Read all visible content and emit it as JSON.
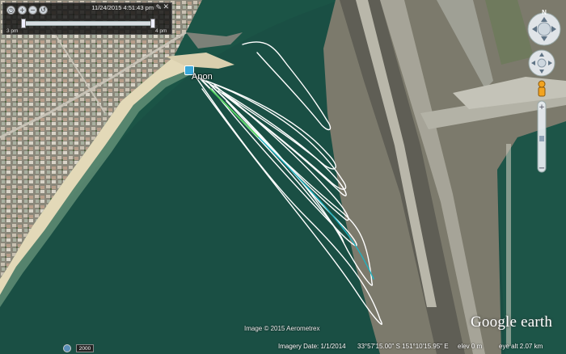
{
  "time_slider": {
    "timestamp": "11/24/2015  4:51:43 pm",
    "start_label": "3 pm",
    "end_label": "4 pm",
    "icons": [
      "clock-icon",
      "zoom-in-time-icon",
      "zoom-out-time-icon",
      "replay-icon",
      "wrench-icon",
      "close-icon"
    ]
  },
  "map": {
    "placemark_label": "Anon",
    "track_colors": {
      "primary": "#ffffff",
      "highlight_green": "#4ad65a",
      "highlight_cyan": "#1fb3c2"
    },
    "credit": "Image © 2015 Aerometrex",
    "brand": "Google earth"
  },
  "status_bar": {
    "year": "2000",
    "imagery_date": "Imagery Date: 1/1/2014",
    "coordinates": "33°57'15.00\" S  151°10'15.95\" E",
    "elevation": "elev    0 m",
    "eye_alt": "eye alt   2.07 km"
  },
  "navigation": {
    "north_label": "N",
    "icons": [
      "look-control-icon",
      "move-control-icon",
      "street-view-pegman-icon",
      "zoom-in-icon",
      "zoom-out-icon"
    ]
  }
}
